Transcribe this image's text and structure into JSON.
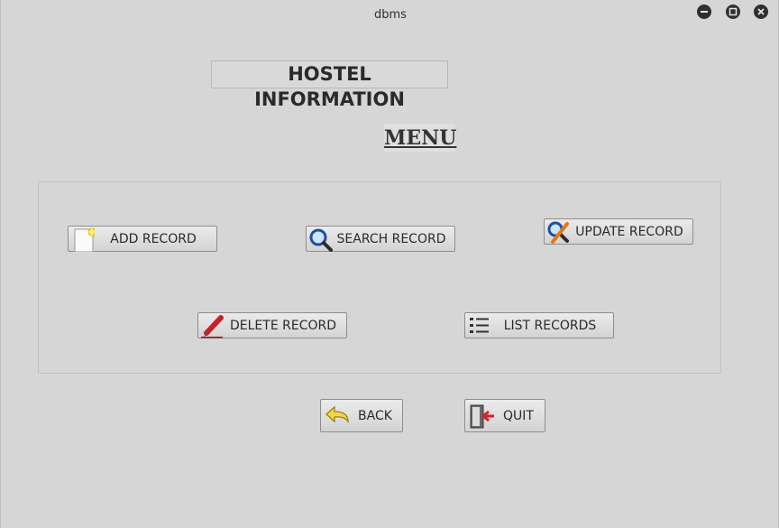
{
  "window": {
    "title": "dbms"
  },
  "heading": "HOSTEL INFORMATION",
  "menu_title": "MENU",
  "buttons": {
    "add": "ADD RECORD",
    "search": "SEARCH RECORD",
    "update": "UPDATE RECORD",
    "delete": "DELETE RECORD",
    "list": "LIST RECORDS",
    "back": "BACK",
    "quit": "QUIT"
  },
  "icons": {
    "add": "new-document-icon",
    "search": "magnifier-icon",
    "update": "edit-search-icon",
    "delete": "pencil-icon",
    "list": "list-icon",
    "back": "back-arrow-icon",
    "quit": "exit-door-icon"
  }
}
